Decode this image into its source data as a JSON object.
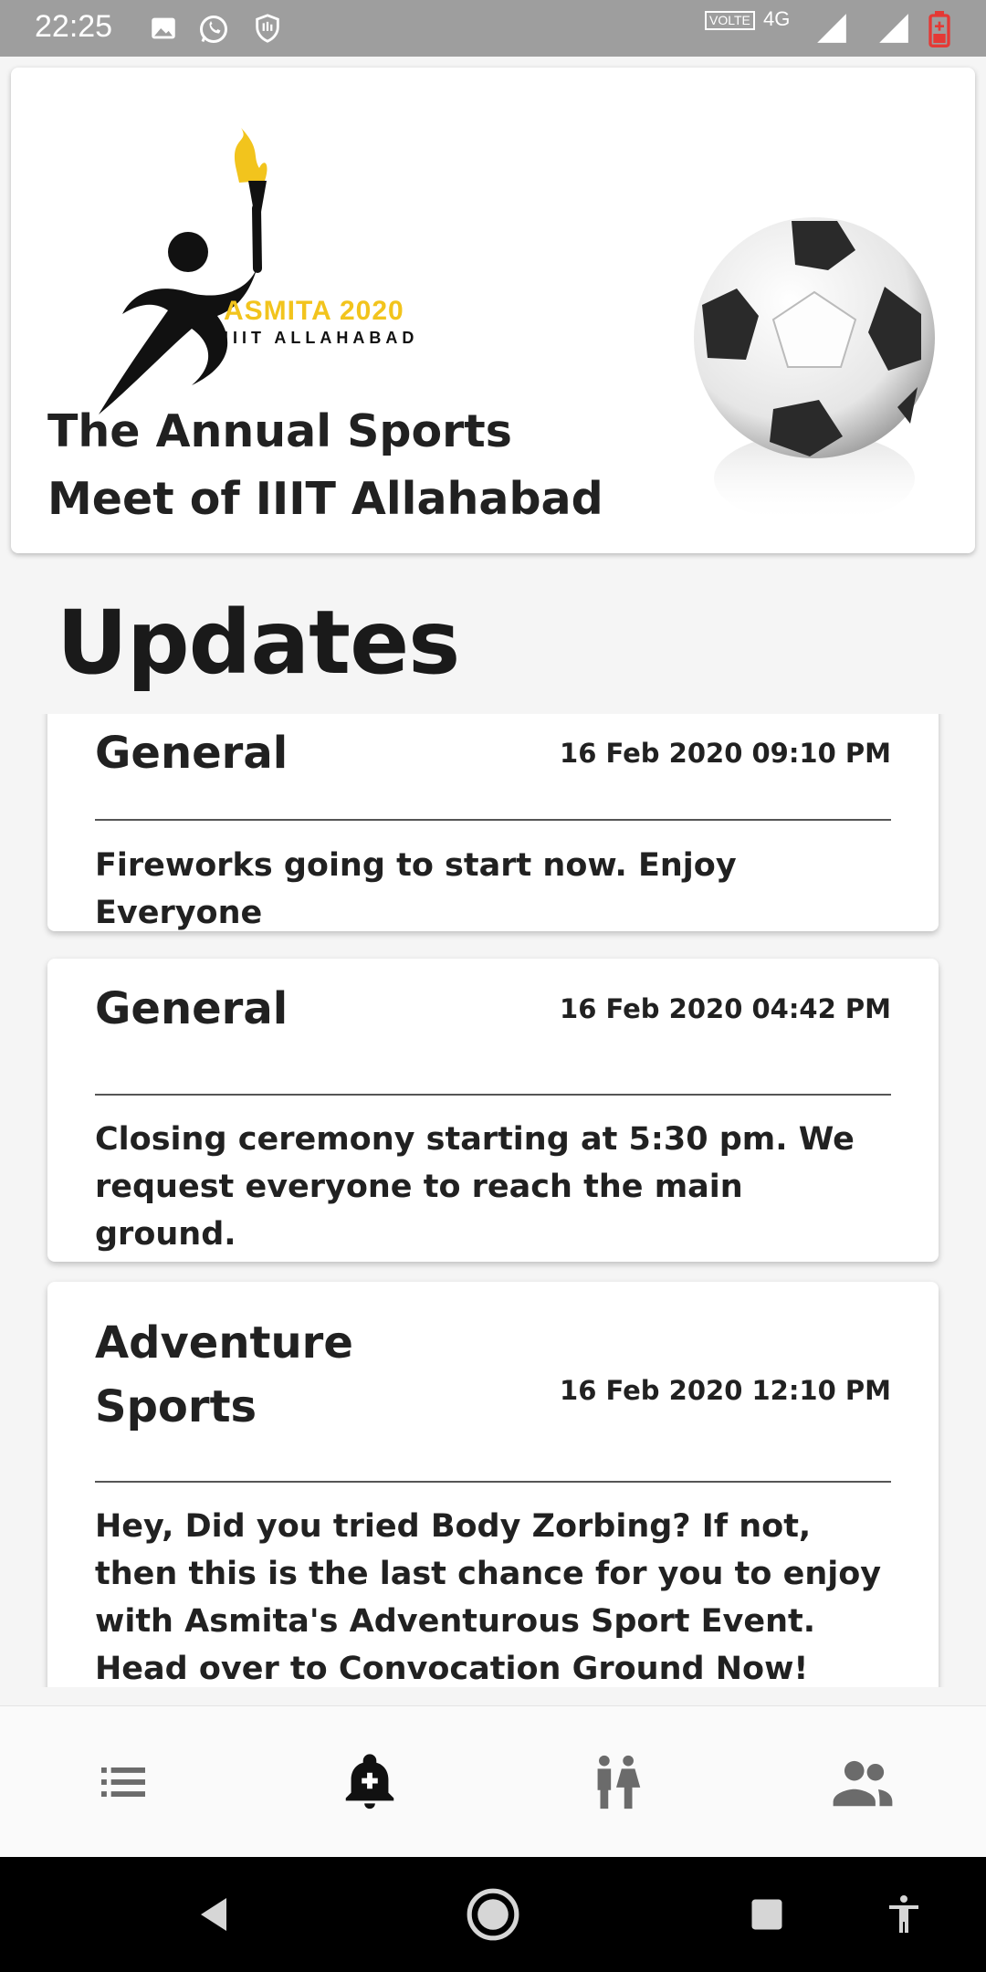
{
  "status_bar": {
    "time": "22:25",
    "volte_label": "VOLTE",
    "network_label": "4G"
  },
  "header": {
    "logo_title": "ASMITA 2020",
    "logo_subtitle": "IIIT ALLAHABAD",
    "tagline": "The Annual Sports Meet of IIIT Allahabad"
  },
  "updates": {
    "heading": "Updates",
    "items": [
      {
        "category": "General",
        "time": "16 Feb 2020 09:10 PM",
        "message": "Fireworks going to start now. Enjoy Everyone"
      },
      {
        "category": "General",
        "time": "16 Feb 2020 04:42 PM",
        "message": "Closing ceremony starting at 5:30 pm. We request everyone to reach the main ground."
      },
      {
        "category": "Adventure Sports",
        "time": "16 Feb 2020 12:10 PM",
        "message": "Hey, Did you tried Body Zorbing? If not, then this is the last chance for you to enjoy with Asmita's Adventurous Sport Event. Head over to Convocation Ground Now!"
      }
    ]
  },
  "bottom_nav": {
    "items": [
      {
        "icon": "list-icon",
        "active": false
      },
      {
        "icon": "notification-add-icon",
        "active": true
      },
      {
        "icon": "people-icon",
        "active": false
      },
      {
        "icon": "group-icon",
        "active": false
      }
    ]
  },
  "colors": {
    "status_bar": "#9e9e9e",
    "brand_yellow": "#f2c41d",
    "active_icon": "#111111",
    "inactive_icon": "#6b6b6b"
  }
}
